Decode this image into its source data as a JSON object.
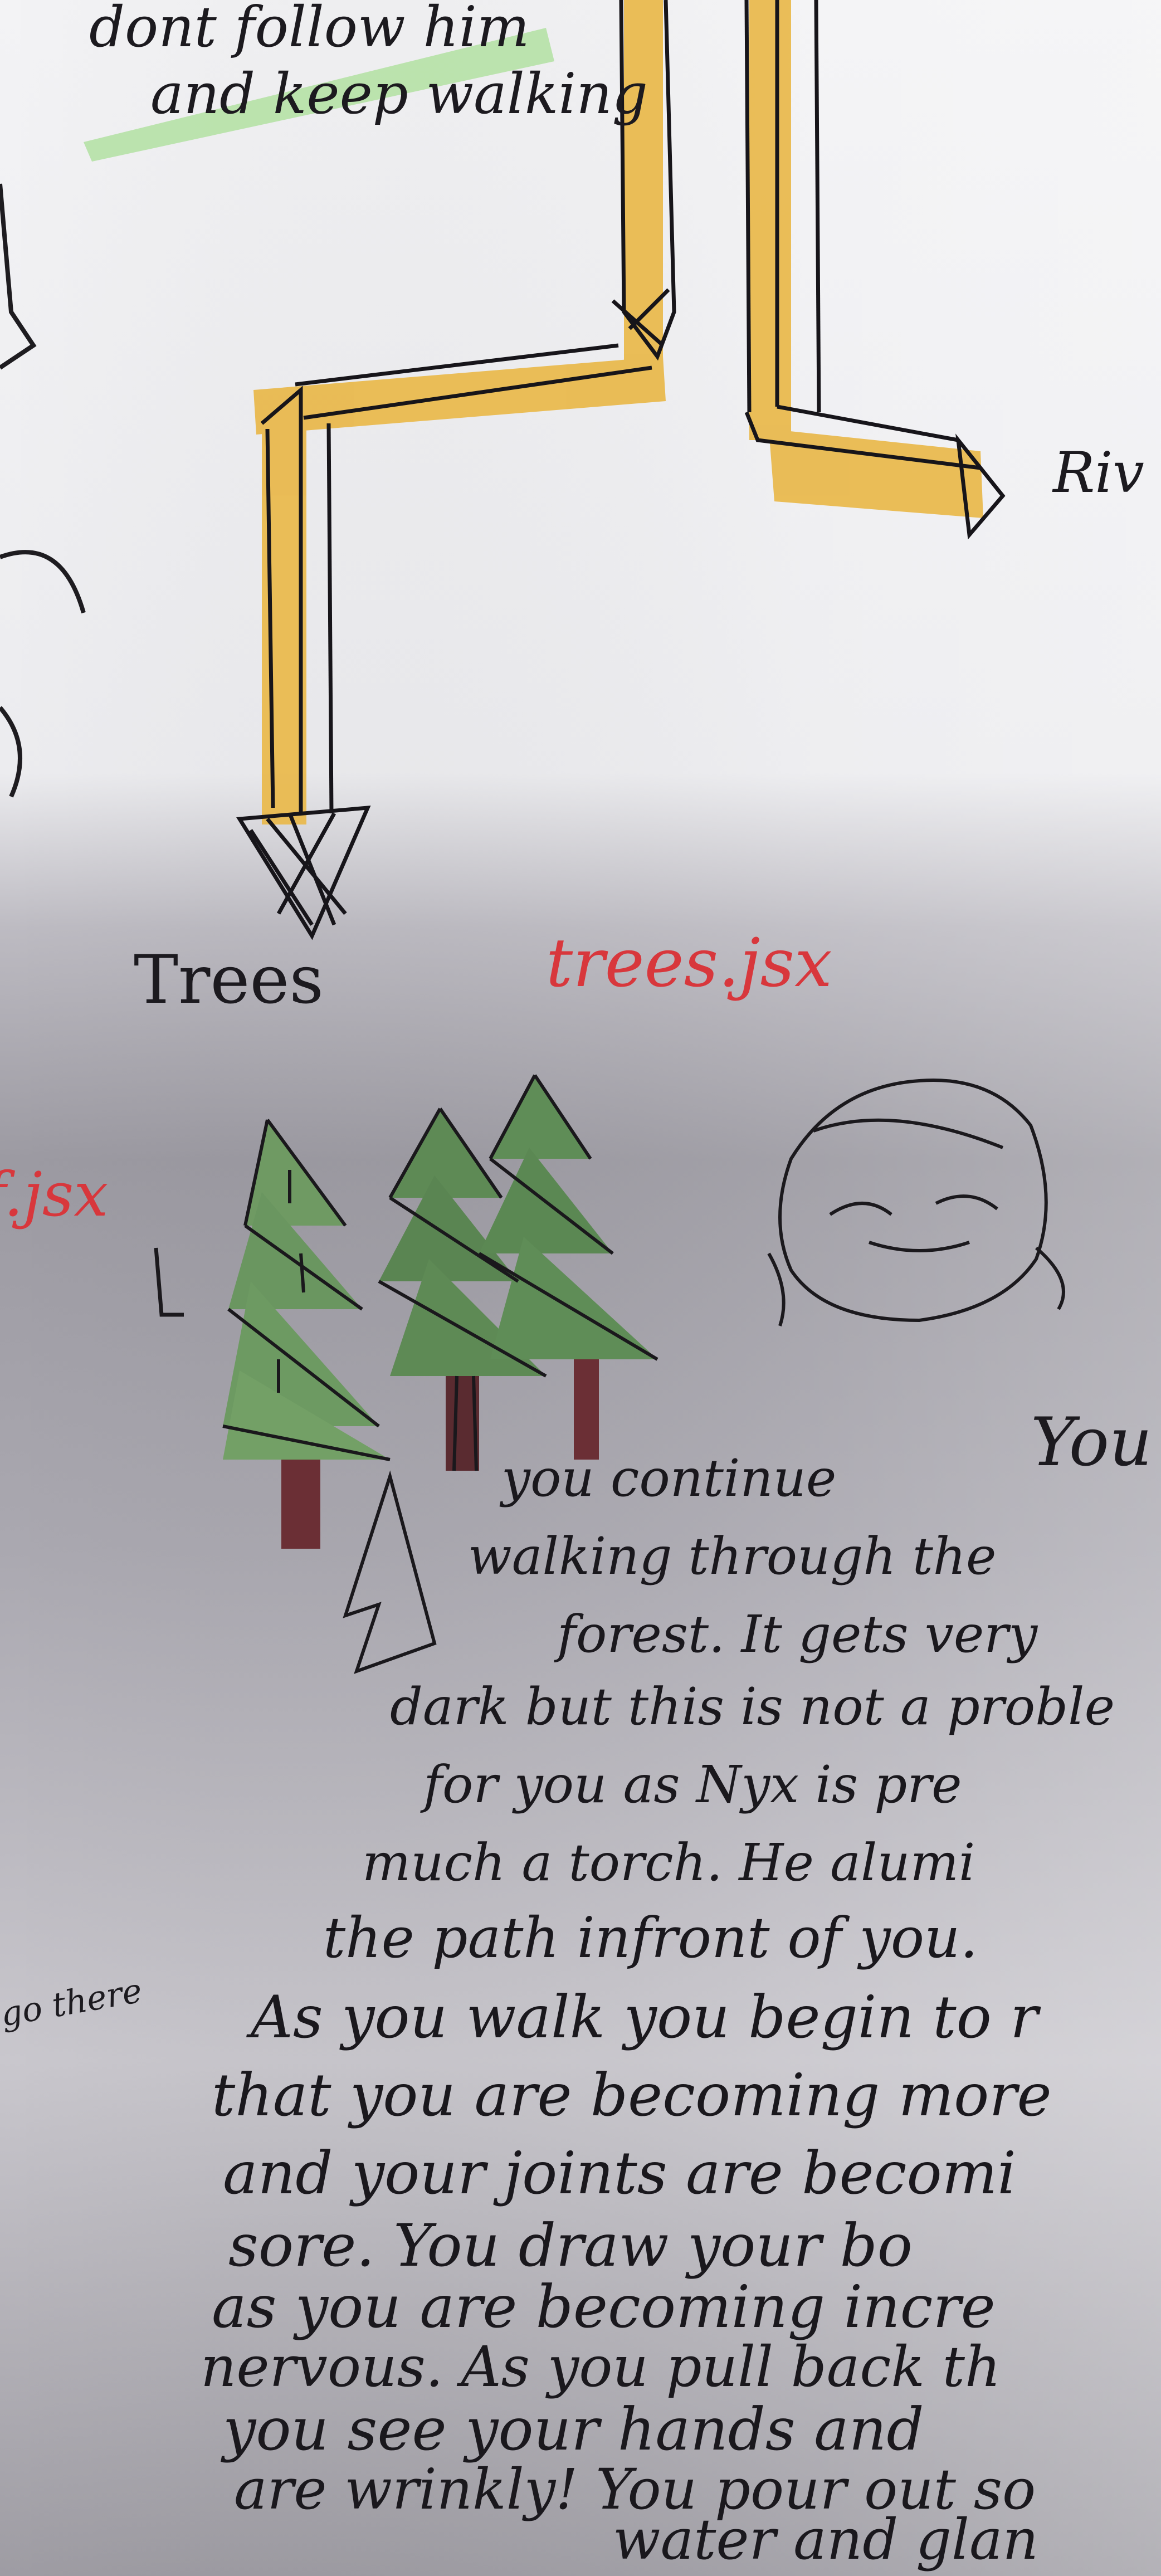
{
  "top_note": {
    "line1": "dont follow him",
    "line2": "and keep walking"
  },
  "labels": {
    "river": "Riv",
    "trees": "Trees",
    "trees_file": "trees.jsx",
    "left_file": "f.jsx",
    "left_arrow": "L",
    "side_note": "go there",
    "right_fragment": "You"
  },
  "story": {
    "lines": [
      "you continue",
      "walking through the",
      "forest. It gets very",
      "dark but this is not a proble",
      "for you as Nyx is pre",
      "much a torch. He alumi",
      "the path infront of you.",
      "As you walk you begin to r",
      "that you are becoming more",
      "and your joints are becomi",
      "sore. You draw your bo",
      "as you are becoming incre",
      "nervous. As you pull back th",
      "you see your hands and",
      "are wrinkly! You pour out so",
      "water and glan"
    ]
  },
  "colors": {
    "paper": "#e9e8ec",
    "path_highlight": "#e9b84a",
    "tree_green": "#5e8a55",
    "trunk": "#6b2f35",
    "red_ink": "#d8373c",
    "green_highlight": "#9fd98e"
  }
}
